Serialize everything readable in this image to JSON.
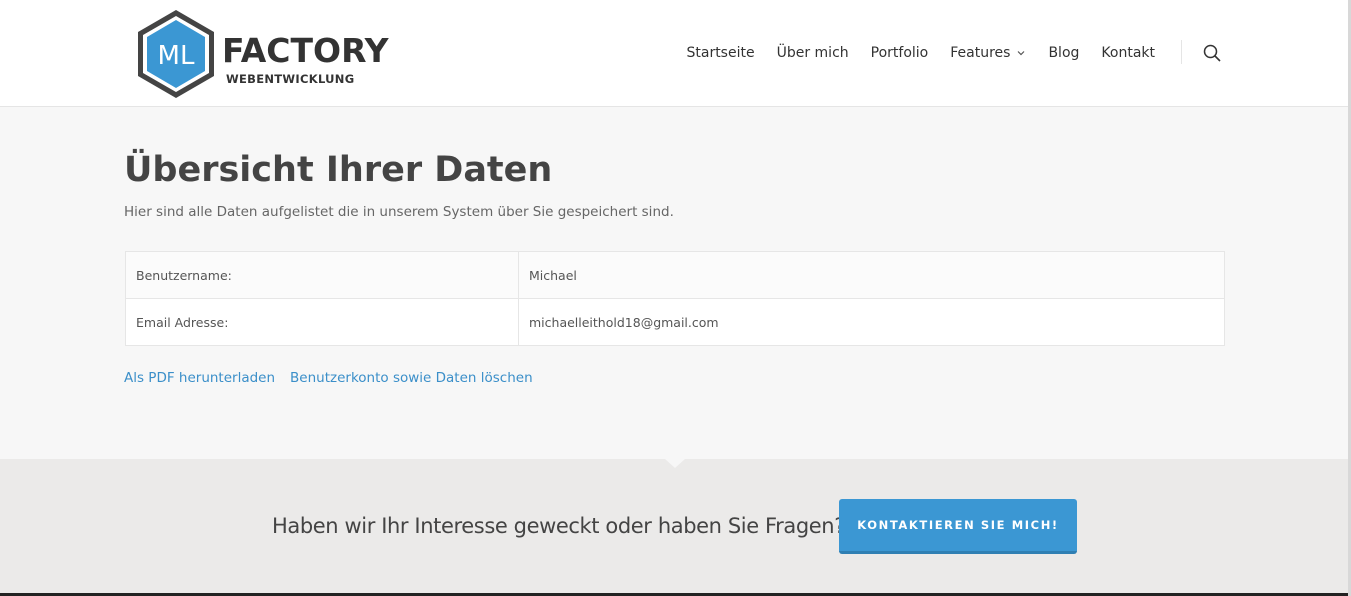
{
  "header": {
    "logo": {
      "mark_text": "ML",
      "brand_main": "FACTORY",
      "brand_sub": "WEBENTWICKLUNG",
      "accent_color": "#3b97d3",
      "frame_color": "#444444"
    },
    "nav": [
      {
        "label": "Startseite"
      },
      {
        "label": "Über mich"
      },
      {
        "label": "Portfolio"
      },
      {
        "label": "Features",
        "has_dropdown": true,
        "icon": "chevron-down-icon"
      },
      {
        "label": "Blog"
      },
      {
        "label": "Kontakt"
      }
    ],
    "search_icon": "search-icon"
  },
  "main": {
    "title": "Übersicht Ihrer Daten",
    "subtitle": "Hier sind alle Daten aufgelistet die in unserem System über Sie gespeichert sind.",
    "table": [
      {
        "key": "Benutzername:",
        "value": "Michael"
      },
      {
        "key": "Email Adresse:",
        "value": "michaelleithold18@gmail.com"
      }
    ],
    "links": {
      "pdf": "Als PDF herunterladen",
      "delete": "Benutzerkonto sowie Daten löschen"
    }
  },
  "cta": {
    "text": "Haben wir Ihr Interesse geweckt oder haben Sie Fragen?",
    "button_label": "KONTAKTIEREN SIE MICH!",
    "button_color": "#3b97d3"
  }
}
